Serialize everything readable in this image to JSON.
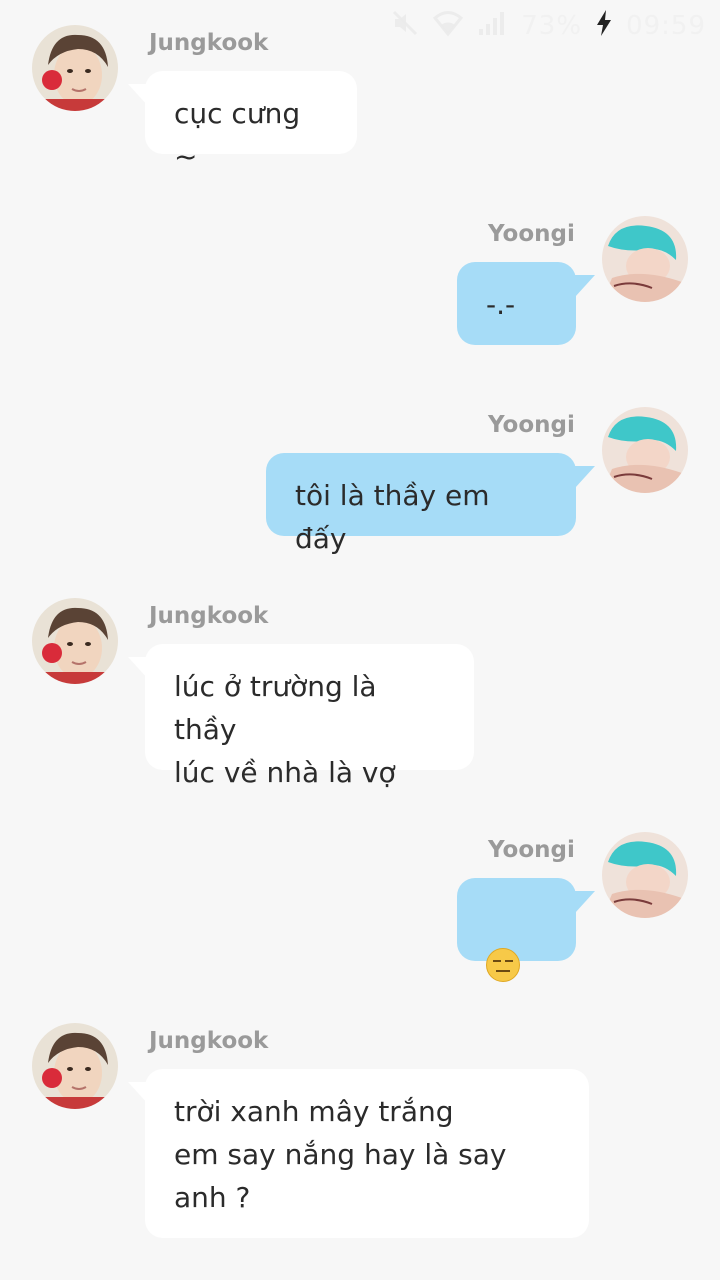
{
  "status_bar": {
    "icons": [
      "mute-icon",
      "wifi-icon",
      "signal-icon"
    ],
    "battery": "73%",
    "time": "09:59"
  },
  "messages": [
    {
      "side": "left",
      "sender": "Jungkook",
      "text": "cục cưng ~",
      "avatar": "jungkook-avatar"
    },
    {
      "side": "right",
      "sender": "Yoongi",
      "text": "-.-",
      "avatar": "yoongi-avatar"
    },
    {
      "side": "right",
      "sender": "Yoongi",
      "text": "tôi là thầy em đấy",
      "avatar": "yoongi-avatar"
    },
    {
      "side": "left",
      "sender": "Jungkook",
      "text": "lúc ở trường là thầy\nlúc về nhà là vợ",
      "avatar": "jungkook-avatar"
    },
    {
      "side": "right",
      "sender": "Yoongi",
      "text": "",
      "emoji": "expressionless-face-icon",
      "avatar": "yoongi-avatar"
    },
    {
      "side": "left",
      "sender": "Jungkook",
      "text": "trời xanh mây trắng\nem say nắng hay là say\nanh ?",
      "avatar": "jungkook-avatar"
    }
  ],
  "colors": {
    "background": "#f7f7f7",
    "left_bubble": "#ffffff",
    "right_bubble": "#a6dcf7",
    "sender_name": "#9a9a9a",
    "text": "#2b2b2b"
  }
}
